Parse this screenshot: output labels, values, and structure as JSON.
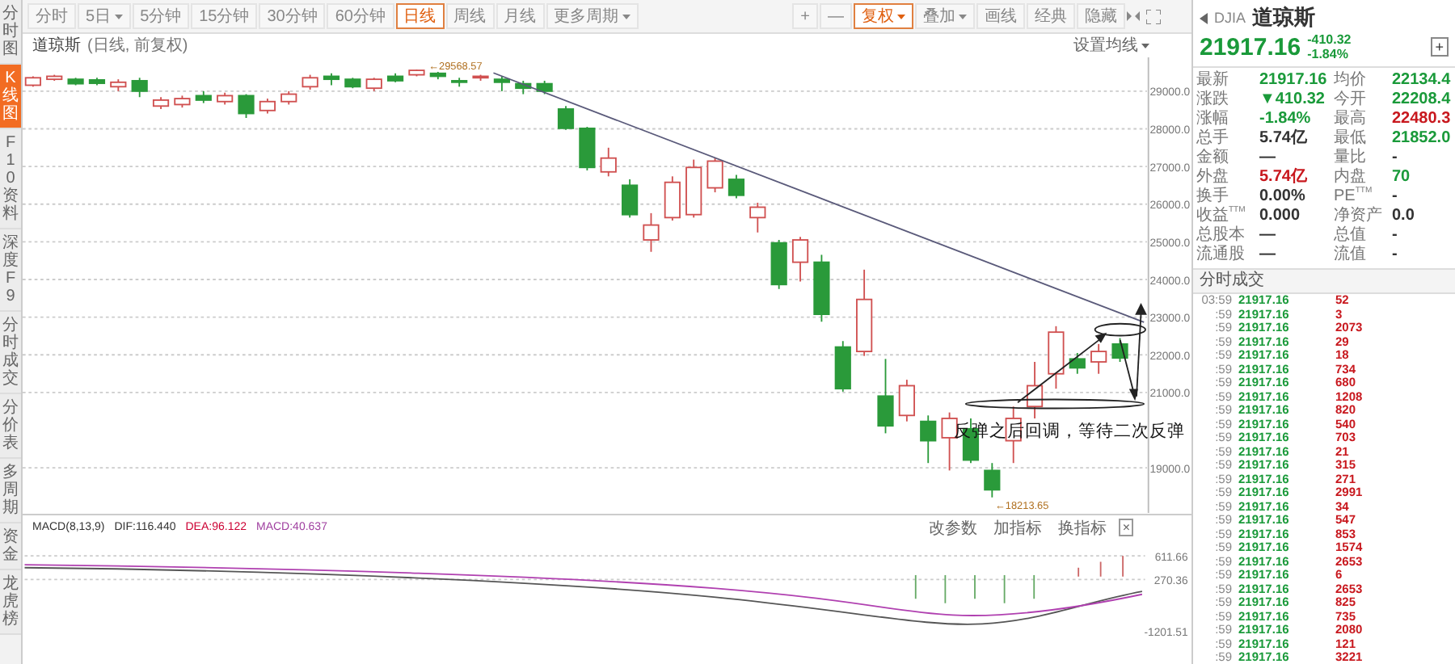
{
  "side_tabs": [
    {
      "label": "分时图",
      "selected": false
    },
    {
      "label": "K线图",
      "selected": true
    },
    {
      "label": "F10资料",
      "selected": false
    },
    {
      "label": "深度F9",
      "selected": false
    },
    {
      "label": "分时成交",
      "selected": false
    },
    {
      "label": "分价表",
      "selected": false
    },
    {
      "label": "多周期",
      "selected": false
    },
    {
      "label": "资金",
      "selected": false
    },
    {
      "label": "龙虎榜",
      "selected": false
    }
  ],
  "periods": [
    {
      "label": "分时",
      "selected": false,
      "dropdown": false
    },
    {
      "label": "5日",
      "selected": false,
      "dropdown": true
    },
    {
      "label": "5分钟",
      "selected": false,
      "dropdown": false
    },
    {
      "label": "15分钟",
      "selected": false,
      "dropdown": false
    },
    {
      "label": "30分钟",
      "selected": false,
      "dropdown": false
    },
    {
      "label": "60分钟",
      "selected": false,
      "dropdown": false
    },
    {
      "label": "日线",
      "selected": true,
      "dropdown": false
    },
    {
      "label": "周线",
      "selected": false,
      "dropdown": false
    },
    {
      "label": "月线",
      "selected": false,
      "dropdown": false
    },
    {
      "label": "更多周期",
      "selected": false,
      "dropdown": true
    }
  ],
  "tools": [
    {
      "label": "+",
      "selected": false,
      "dropdown": false
    },
    {
      "label": "—",
      "selected": false,
      "dropdown": false
    },
    {
      "label": "复权",
      "selected": true,
      "dropdown": true
    },
    {
      "label": "叠加",
      "selected": false,
      "dropdown": true
    },
    {
      "label": "画线",
      "selected": false,
      "dropdown": false
    },
    {
      "label": "经典",
      "selected": false,
      "dropdown": false
    },
    {
      "label": "隐藏",
      "selected": false,
      "dropdown": false
    }
  ],
  "chart": {
    "title": "道琼斯",
    "subtitle": "(日线, 前复权)",
    "ma_setting": "设置均线",
    "high_label": "←29568.57",
    "low_label": "←18213.65",
    "annotation": "反弹之后回调，等待二次反弹",
    "chart_data": {
      "type": "candlestick",
      "grid": true,
      "ylim": [
        17800,
        29900
      ],
      "yticks": [
        {
          "value": 29000,
          "label": "29000.0"
        },
        {
          "value": 28000,
          "label": "28000.0"
        },
        {
          "value": 27000,
          "label": "27000.0"
        },
        {
          "value": 26000,
          "label": "26000.0"
        },
        {
          "value": 25000,
          "label": "25000.0"
        },
        {
          "value": 24000,
          "label": "24000.0"
        },
        {
          "value": 23000,
          "label": "23000.0"
        },
        {
          "value": 22000,
          "label": "22000.0"
        },
        {
          "value": 21000,
          "label": "21000.0"
        },
        {
          "value": 19000,
          "label": "19000.0"
        }
      ],
      "ohlc": [
        [
          29159,
          29396,
          29120,
          29357
        ],
        [
          29317,
          29436,
          29278,
          29396
        ],
        [
          29317,
          29357,
          29159,
          29199
        ],
        [
          29300,
          29357,
          29159,
          29210
        ],
        [
          29120,
          29317,
          29001,
          29238
        ],
        [
          29278,
          29357,
          28843,
          29001
        ],
        [
          28606,
          28843,
          28527,
          28764
        ],
        [
          28646,
          28882,
          28566,
          28804
        ],
        [
          28882,
          29001,
          28685,
          28764
        ],
        [
          28725,
          28961,
          28646,
          28882
        ],
        [
          28882,
          28922,
          28290,
          28408
        ],
        [
          28488,
          28804,
          28408,
          28725
        ],
        [
          28725,
          29001,
          28646,
          28922
        ],
        [
          29120,
          29436,
          29041,
          29357
        ],
        [
          29396,
          29475,
          29159,
          29317
        ],
        [
          29317,
          29357,
          29080,
          29120
        ],
        [
          29080,
          29357,
          29001,
          29317
        ],
        [
          29396,
          29475,
          29238,
          29278
        ],
        [
          29436,
          29569,
          29396,
          29554
        ],
        [
          29475,
          29514,
          29317,
          29396
        ],
        [
          29278,
          29357,
          29120,
          29238
        ],
        [
          29357,
          29436,
          29278,
          29396
        ],
        [
          29317,
          29396,
          29001,
          29238
        ],
        [
          29199,
          29278,
          28922,
          29080
        ],
        [
          29199,
          29278,
          28922,
          29001
        ],
        [
          28527,
          28606,
          27974,
          28014
        ],
        [
          28014,
          28053,
          26897,
          26976
        ],
        [
          26858,
          27500,
          26739,
          27224
        ],
        [
          26502,
          26660,
          25644,
          25723
        ],
        [
          25051,
          25762,
          24735,
          25446
        ],
        [
          25644,
          26739,
          25565,
          26581
        ],
        [
          25723,
          27184,
          25644,
          26976
        ],
        [
          26434,
          27224,
          26315,
          27144
        ],
        [
          26660,
          26778,
          26157,
          26236
        ],
        [
          25644,
          26039,
          25249,
          25920
        ],
        [
          24972,
          25051,
          23748,
          23866
        ],
        [
          24459,
          25130,
          23945,
          25051
        ],
        [
          24459,
          24656,
          22879,
          23076
        ],
        [
          22207,
          22365,
          21022,
          21101
        ],
        [
          22089,
          24261,
          21970,
          23471
        ],
        [
          20904,
          21891,
          19916,
          20114
        ],
        [
          20390,
          21338,
          20232,
          21180
        ],
        [
          20232,
          20390,
          19126,
          19719
        ],
        [
          19798,
          20469,
          18929,
          20311
        ],
        [
          20035,
          20311,
          19126,
          19205
        ],
        [
          18929,
          19126,
          18214,
          18415
        ],
        [
          19719,
          20627,
          19126,
          20311
        ],
        [
          20627,
          21812,
          20311,
          21180
        ],
        [
          21496,
          22760,
          21101,
          22602
        ],
        [
          21891,
          22049,
          21496,
          21654
        ],
        [
          21812,
          22286,
          21496,
          22089
        ],
        [
          22286,
          22444,
          21812,
          21917
        ]
      ]
    }
  },
  "macd": {
    "label": "MACD(8,13,9)",
    "dif": "DIF:116.440",
    "dea": "DEA:96.122",
    "value": "MACD:40.637",
    "buttons": [
      "改参数",
      "加指标",
      "换指标"
    ],
    "close": "×",
    "y_ticks": [
      "611.66",
      "270.36",
      "-1201.51"
    ]
  },
  "quote": {
    "code": "DJIA",
    "name": "道琼斯",
    "price": "21917.16",
    "change": "-410.32",
    "change_pct": "-1.84%",
    "add": "+",
    "rows": [
      [
        {
          "label": "最新",
          "value": "21917.16",
          "color": "#1a9a3a"
        },
        {
          "label": "均价",
          "value": "22134.4",
          "color": "#1a9a3a"
        }
      ],
      [
        {
          "label": "涨跌",
          "value": "▼410.32",
          "color": "#1a9a3a"
        },
        {
          "label": "今开",
          "value": "22208.4",
          "color": "#1a9a3a"
        }
      ],
      [
        {
          "label": "涨幅",
          "value": "-1.84%",
          "color": "#1a9a3a"
        },
        {
          "label": "最高",
          "value": "22480.3",
          "color": "#c8181e"
        }
      ],
      [
        {
          "label": "总手",
          "value": "5.74亿",
          "color": "#333333"
        },
        {
          "label": "最低",
          "value": "21852.0",
          "color": "#1a9a3a"
        }
      ],
      [
        {
          "label": "金额",
          "value": "—",
          "color": "#333333"
        },
        {
          "label": "量比",
          "value": "-",
          "color": "#333333"
        }
      ],
      [
        {
          "label": "外盘",
          "value": "5.74亿",
          "color": "#c8181e"
        },
        {
          "label": "内盘",
          "value": "70",
          "color": "#1a9a3a"
        }
      ],
      [
        {
          "label": "换手",
          "value": "0.00%",
          "color": "#333333"
        },
        {
          "label": "PE$^{TTM}$",
          "value": "-",
          "color": "#333333"
        }
      ],
      [
        {
          "label": "收益$^{TTM}$",
          "value": "0.000",
          "color": "#333333"
        },
        {
          "label": "净资产",
          "value": "0.0",
          "color": "#333333"
        }
      ],
      [
        {
          "label": "总股本",
          "value": "—",
          "color": "#333333"
        },
        {
          "label": "总值",
          "value": "-",
          "color": "#333333"
        }
      ],
      [
        {
          "label": "流通股",
          "value": "—",
          "color": "#333333"
        },
        {
          "label": "流值",
          "value": "-",
          "color": "#333333"
        }
      ]
    ]
  },
  "trades": {
    "title": "分时成交",
    "rows": [
      {
        "time": "03:59",
        "price": "21917.16",
        "volume": "52"
      },
      {
        "time": ":59",
        "price": "21917.16",
        "volume": "3"
      },
      {
        "time": ":59",
        "price": "21917.16",
        "volume": "2073"
      },
      {
        "time": ":59",
        "price": "21917.16",
        "volume": "29"
      },
      {
        "time": ":59",
        "price": "21917.16",
        "volume": "18"
      },
      {
        "time": ":59",
        "price": "21917.16",
        "volume": "734"
      },
      {
        "time": ":59",
        "price": "21917.16",
        "volume": "680"
      },
      {
        "time": ":59",
        "price": "21917.16",
        "volume": "1208"
      },
      {
        "time": ":59",
        "price": "21917.16",
        "volume": "820"
      },
      {
        "time": ":59",
        "price": "21917.16",
        "volume": "540"
      },
      {
        "time": ":59",
        "price": "21917.16",
        "volume": "703"
      },
      {
        "time": ":59",
        "price": "21917.16",
        "volume": "21"
      },
      {
        "time": ":59",
        "price": "21917.16",
        "volume": "315"
      },
      {
        "time": ":59",
        "price": "21917.16",
        "volume": "271"
      },
      {
        "time": ":59",
        "price": "21917.16",
        "volume": "2991"
      },
      {
        "time": ":59",
        "price": "21917.16",
        "volume": "34"
      },
      {
        "time": ":59",
        "price": "21917.16",
        "volume": "547"
      },
      {
        "time": ":59",
        "price": "21917.16",
        "volume": "853"
      },
      {
        "time": ":59",
        "price": "21917.16",
        "volume": "1574"
      },
      {
        "time": ":59",
        "price": "21917.16",
        "volume": "2653"
      },
      {
        "time": ":59",
        "price": "21917.16",
        "volume": "6"
      },
      {
        "time": ":59",
        "price": "21917.16",
        "volume": "2653"
      },
      {
        "time": ":59",
        "price": "21917.16",
        "volume": "825"
      },
      {
        "time": ":59",
        "price": "21917.16",
        "volume": "735"
      },
      {
        "time": ":59",
        "price": "21917.16",
        "volume": "2080"
      },
      {
        "time": ":59",
        "price": "21917.16",
        "volume": "121"
      },
      {
        "time": ":59",
        "price": "21917.16",
        "volume": "3221"
      }
    ]
  }
}
